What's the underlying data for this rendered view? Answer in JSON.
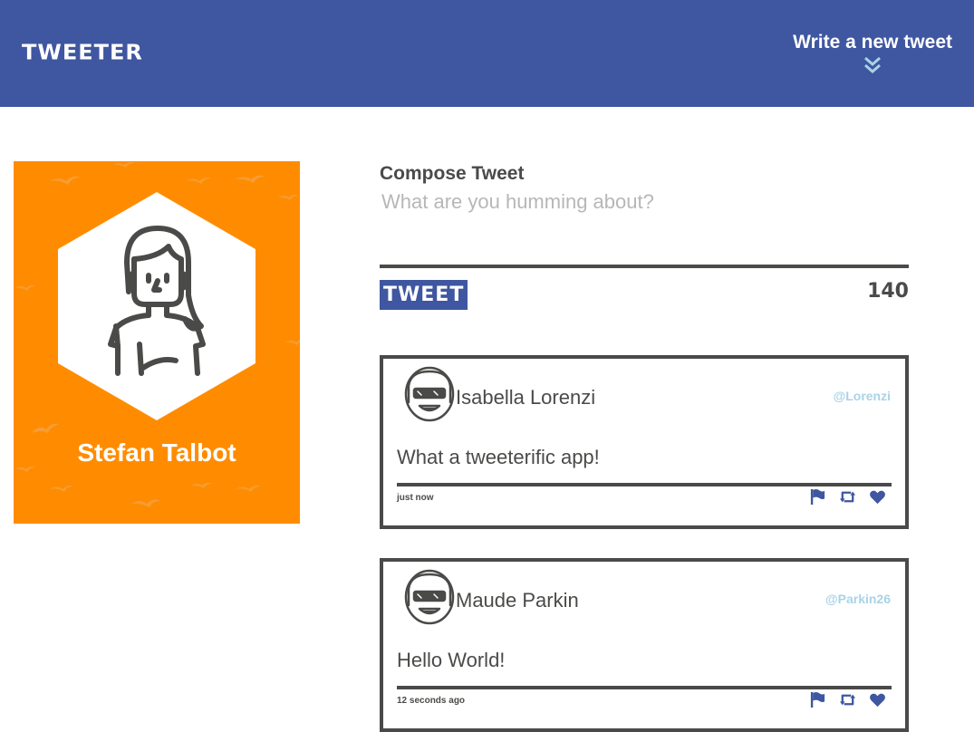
{
  "header": {
    "brand": "TWEETER",
    "new_tweet_label": "Write a new tweet",
    "toggle_icon": "double-chevron-down-icon"
  },
  "colors": {
    "header_bg": "#3f56a0",
    "profile_bg": "#ff8c00",
    "border": "#4a4a48",
    "handle": "#a9d3e6",
    "accent": "#3f56a0"
  },
  "profile": {
    "name": "Stefan Talbot",
    "avatar_icon": "person-avatar-icon"
  },
  "compose": {
    "title": "Compose Tweet",
    "placeholder": "What are you humming about?",
    "value": "",
    "button_label": "TWEET",
    "counter": "140"
  },
  "tweets": [
    {
      "name": "Isabella Lorenzi",
      "handle": "@Lorenzi",
      "text": "What a tweeterific app!",
      "time": "just now",
      "actions": [
        "flag-icon",
        "retweet-icon",
        "heart-icon"
      ]
    },
    {
      "name": "Maude Parkin",
      "handle": "@Parkin26",
      "text": "Hello World!",
      "time": "12 seconds ago",
      "actions": [
        "flag-icon",
        "retweet-icon",
        "heart-icon"
      ]
    }
  ]
}
